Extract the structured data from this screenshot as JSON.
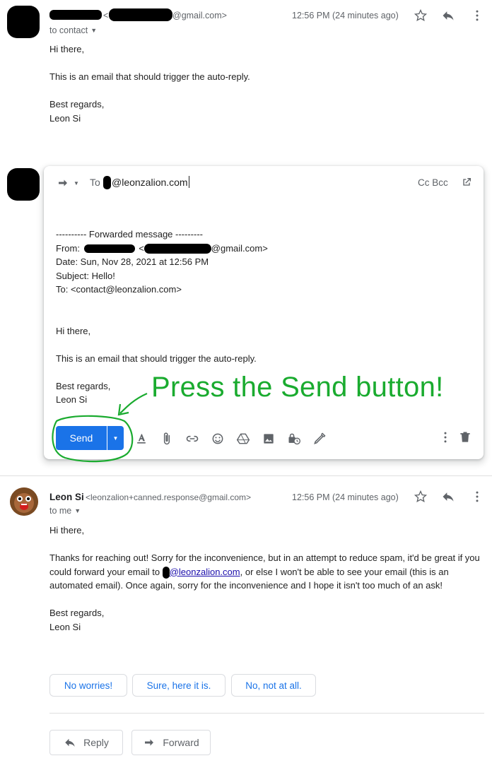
{
  "email1": {
    "to_line": "to contact",
    "sender_email_suffix": "@gmail.com>",
    "sender_email_open": "<",
    "time": "12:56 PM (24 minutes ago)",
    "body": [
      "Hi there,",
      "This is an email that should trigger the auto-reply.",
      "Best regards,",
      "Leon Si"
    ]
  },
  "compose": {
    "to_label": "To",
    "to_value": "@leonzalion.com",
    "cc_bcc": "Cc Bcc",
    "forward_header": "---------- Forwarded message ---------",
    "from_label": "From:",
    "from_lt": "<",
    "from_suffix": "@gmail.com>",
    "date_line": "Date: Sun, Nov 28, 2021 at 12:56 PM",
    "subject_line": "Subject: Hello!",
    "to_line": "To: <contact@leonzalion.com>",
    "body": [
      "Hi there,",
      "This is an email that should trigger the auto-reply.",
      "Best regards,",
      "Leon Si"
    ],
    "send_label": "Send"
  },
  "annotation": {
    "text": "Press the Send button!",
    "color": "#1aab2f"
  },
  "email2": {
    "sender_name": "Leon Si",
    "sender_email": "<leonzalion+canned.response@gmail.com>",
    "time": "12:56 PM (24 minutes ago)",
    "to_line": "to me",
    "greeting": "Hi there,",
    "para_part1": "Thanks for reaching out! Sorry for the inconvenience, but in an attempt to reduce spam, it'd be great if you could forward your email to ",
    "para_link": "@leonzalion.com",
    "para_part2": ", or else I won't be able to see your email (this is an automated email). Once again, sorry for the inconvenience and I hope it isn't too much of an ask!",
    "signoff": [
      "Best regards,",
      "Leon Si"
    ]
  },
  "smart_replies": [
    "No worries!",
    "Sure, here it is.",
    "No, not at all."
  ],
  "actions": {
    "reply": "Reply",
    "forward": "Forward"
  },
  "colors": {
    "accent": "#1a73e8",
    "annotation": "#1aab2f"
  }
}
